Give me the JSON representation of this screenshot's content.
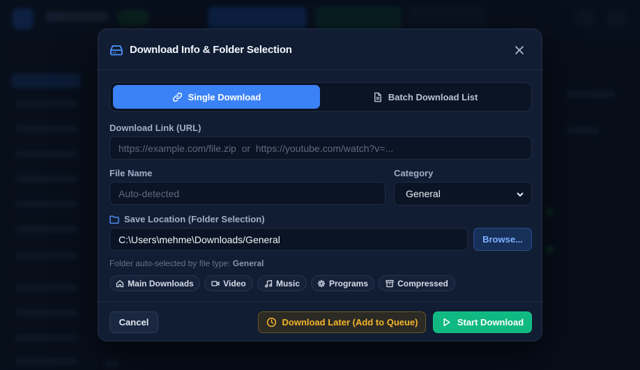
{
  "dialog": {
    "title": "Download Info & Folder Selection",
    "close_icon": "close-icon",
    "header_icon": "drive-icon"
  },
  "tabs": [
    {
      "label": "Single Download",
      "icon": "link-icon",
      "active": true
    },
    {
      "label": "Batch Download List",
      "icon": "document-icon",
      "active": false
    }
  ],
  "url_field": {
    "label": "Download Link (URL)",
    "value": "",
    "placeholder": "https://example.com/file.zip  or  https://youtube.com/watch?v=..."
  },
  "file_name": {
    "label": "File Name",
    "value": "",
    "placeholder": "Auto-detected"
  },
  "category": {
    "label": "Category",
    "selected": "General"
  },
  "save_location": {
    "label": "Save Location (Folder Selection)",
    "path": "C:\\Users\\mehme\\Downloads/General",
    "browse_label": "Browse..."
  },
  "hint": {
    "prefix": "Folder auto-selected by file type:",
    "type": "General"
  },
  "folder_chips": [
    {
      "label": "Main Downloads",
      "icon": "home-icon"
    },
    {
      "label": "Video",
      "icon": "video-icon"
    },
    {
      "label": "Music",
      "icon": "music-icon"
    },
    {
      "label": "Programs",
      "icon": "gear-icon"
    },
    {
      "label": "Compressed",
      "icon": "archive-icon"
    }
  ],
  "footer": {
    "cancel_label": "Cancel",
    "later_label": "Download Later (Add to Queue)",
    "start_label": "Start Download"
  },
  "colors": {
    "accent_blue": "#3b82f6",
    "start_green": "#10b981",
    "later_amber": "#f3b52c",
    "modal_bg": "#111d33"
  }
}
